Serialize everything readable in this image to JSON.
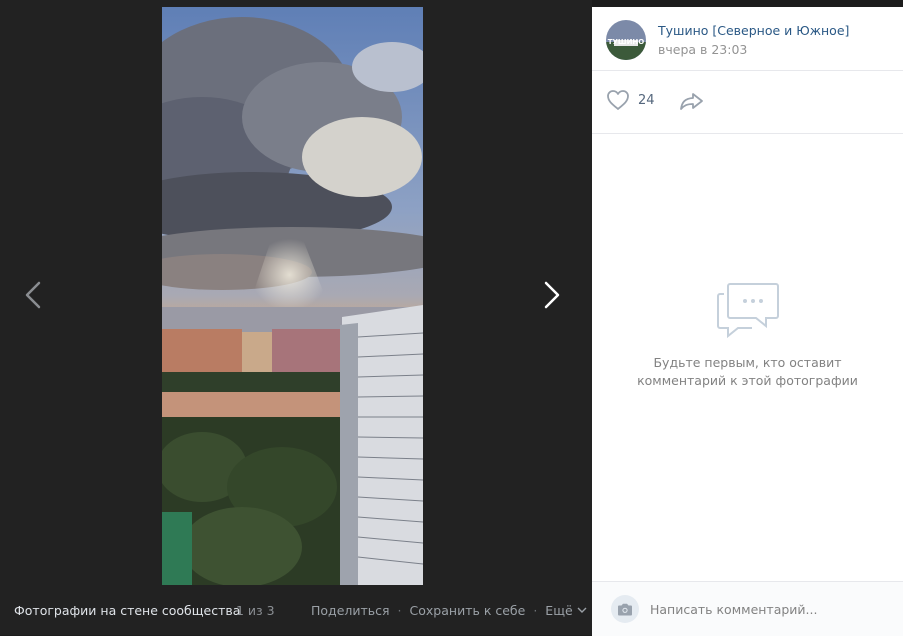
{
  "album": {
    "title": "Фотографии на стене сообщества",
    "counter": "1 из 3"
  },
  "actions": {
    "share": "Поделиться",
    "save": "Сохранить к себе",
    "more": "Ещё"
  },
  "post": {
    "author": "Тушино [Северное и Южное]",
    "time": "вчера в 23:03",
    "avatar_text": "ТУШИНО",
    "likes": "24"
  },
  "comments": {
    "empty_line1": "Будьте первым, кто оставит",
    "empty_line2": "комментарий к этой фотографии",
    "placeholder": "Написать комментарий..."
  },
  "icons": {
    "prev": "chevron-left-icon",
    "next": "chevron-right-icon",
    "like": "heart-icon",
    "share": "share-arrow-icon",
    "empty": "speech-bubble-icon",
    "camera": "camera-icon",
    "more": "chevron-down-icon"
  },
  "colors": {
    "link": "#2a5885",
    "viewer_bg": "#222222",
    "muted": "#828282"
  }
}
